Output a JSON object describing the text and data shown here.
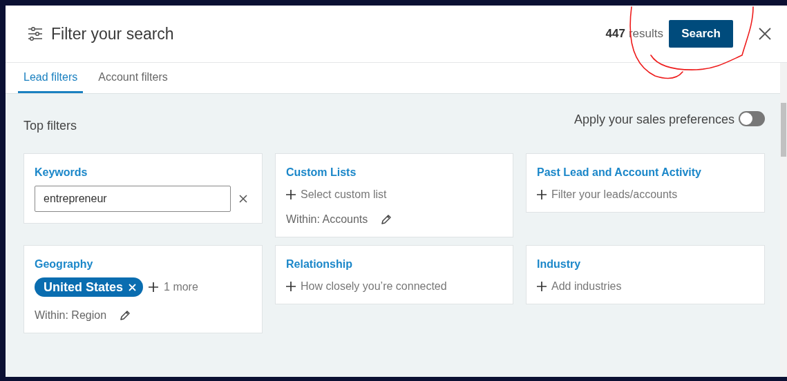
{
  "header": {
    "title": "Filter your search",
    "result_count": "447",
    "results_label": "results",
    "search_button": "Search"
  },
  "tabs": [
    {
      "label": "Lead filters",
      "selected": true
    },
    {
      "label": "Account filters",
      "selected": false
    }
  ],
  "section_title": "Top filters",
  "preferences_toggle": {
    "label": "Apply your sales preferences",
    "on": false
  },
  "filters": [
    {
      "kind": "text",
      "title": "Keywords",
      "value": "entrepreneur"
    },
    {
      "kind": "add",
      "title": "Custom Lists",
      "prompt": "Select custom list",
      "within": "Within: Accounts"
    },
    {
      "kind": "add",
      "title": "Past Lead and Account Activity",
      "prompt": "Filter your leads/accounts"
    },
    {
      "kind": "chips",
      "title": "Geography",
      "chips": [
        "United States"
      ],
      "more": "1 more",
      "within": "Within: Region"
    },
    {
      "kind": "add",
      "title": "Relationship",
      "prompt": "How closely you’re connected"
    },
    {
      "kind": "add",
      "title": "Industry",
      "prompt": "Add industries"
    }
  ]
}
